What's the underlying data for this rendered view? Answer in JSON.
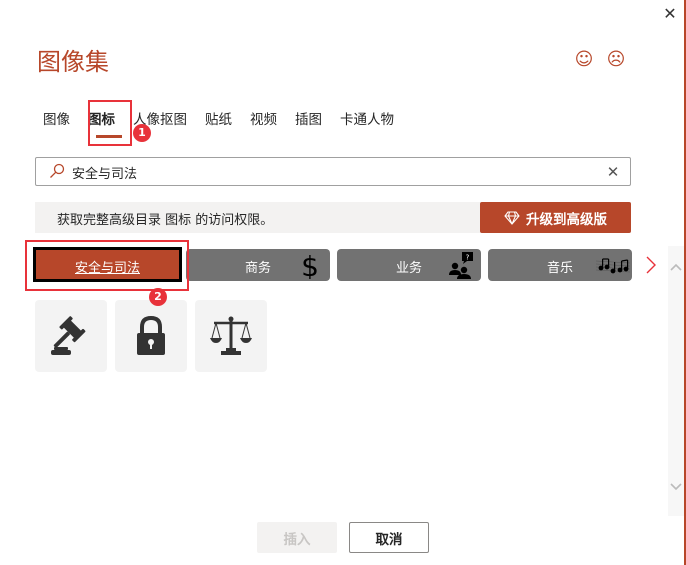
{
  "dialog": {
    "title": "图像集",
    "close_icon": "close-icon",
    "feedback": {
      "smile": "☺",
      "frown": "☹"
    }
  },
  "tabs": [
    {
      "label": "图像",
      "active": false
    },
    {
      "label": "图标",
      "active": true
    },
    {
      "label": "人像抠图",
      "active": false
    },
    {
      "label": "贴纸",
      "active": false
    },
    {
      "label": "视频",
      "active": false
    },
    {
      "label": "插图",
      "active": false
    },
    {
      "label": "卡通人物",
      "active": false
    }
  ],
  "search": {
    "value": "安全与司法",
    "placeholder": ""
  },
  "banner": {
    "text": "获取完整高级目录 图标 的访问权限。",
    "upgrade_label": "升级到高级版"
  },
  "categories": [
    {
      "label": "安全与司法",
      "icon": "none",
      "active": true
    },
    {
      "label": "商务",
      "icon": "dollar-icon",
      "active": false
    },
    {
      "label": "业务",
      "icon": "people-chat-icon",
      "active": false
    },
    {
      "label": "音乐",
      "icon": "music-notes-icon",
      "active": false
    }
  ],
  "results": [
    {
      "icon": "gavel-icon"
    },
    {
      "icon": "padlock-icon"
    },
    {
      "icon": "scales-icon"
    }
  ],
  "annotations": [
    {
      "number": "1"
    },
    {
      "number": "2"
    }
  ],
  "footer": {
    "insert_label": "插入",
    "cancel_label": "取消"
  },
  "colors": {
    "accent": "#b7472a",
    "annotation": "#e8323a",
    "category_bg": "#727272"
  }
}
